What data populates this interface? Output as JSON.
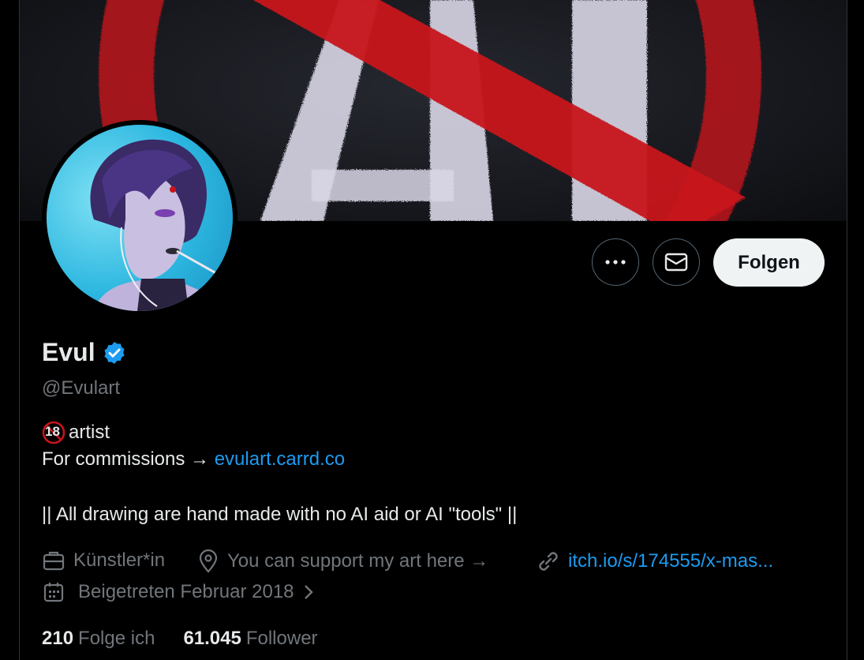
{
  "profile": {
    "name": "Evul",
    "handle": "@Evulart",
    "verified": true
  },
  "banner": {
    "text": "AI",
    "accent": "#c8141c"
  },
  "actions": {
    "more_icon": "more-horizontal-icon",
    "message_icon": "envelope-icon",
    "follow_label": "Folgen"
  },
  "bio": {
    "badge": "18",
    "line1": "artist",
    "line2_prefix": "For commissions → ",
    "line2_link": "evulart.carrd.co",
    "line3": "|| All drawing are hand made with no AI aid or AI \"tools\" ||"
  },
  "meta": {
    "category": "Künstler*in",
    "location": "You can support my art here →",
    "website": "itch.io/s/174555/x-mas...",
    "joined": "Beigetreten Februar 2018"
  },
  "stats": {
    "following_count": "210",
    "following_label": "Folge ich",
    "followers_count": "61.045",
    "followers_label": "Follower"
  },
  "colors": {
    "accent": "#1d9bf0",
    "muted": "#71767b",
    "text": "#e7e9ea",
    "background": "#000000"
  }
}
